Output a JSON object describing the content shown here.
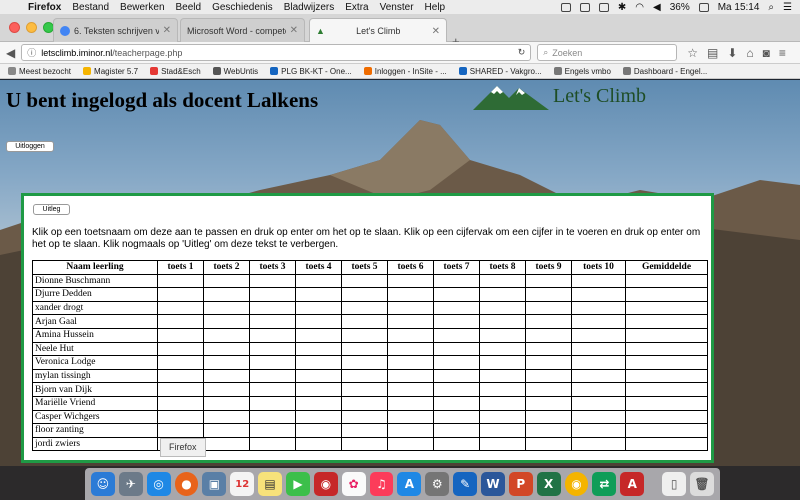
{
  "menubar": {
    "items": [
      "Firefox",
      "Bestand",
      "Bewerken",
      "Beeld",
      "Geschiedenis",
      "Bladwijzers",
      "Extra",
      "Venster",
      "Help"
    ],
    "battery": "36%",
    "clock": "Ma 15:14"
  },
  "tabs": [
    {
      "label": "6. Teksten schrijven voor de..."
    },
    {
      "label": "Microsoft Word - competenties ..."
    },
    {
      "label": "Let's Climb"
    }
  ],
  "navbar": {
    "url_host": "letsclimb.iminor.nl",
    "url_path": "/teacherpage.php",
    "search_placeholder": "Zoeken"
  },
  "bookmarks": [
    "Meest bezocht",
    "Magister 5.7",
    "Stad&Esch",
    "WebUntis",
    "PLG BK-KT - One...",
    "Inloggen - InSite - ...",
    "SHARED - Vakgro...",
    "Engels vmbo",
    "Dashboard - Engel..."
  ],
  "page": {
    "title": "U bent ingelogd als docent Lalkens",
    "brand": "Let's Climb",
    "logout_label": "Uitloggen",
    "uitleg_label": "Uitleg",
    "instructions": "Klik op een toetsnaam om deze aan te passen en druk op enter om het op te slaan. Klik op een cijfervak om een cijfer in te voeren en druk op enter om het op te slaan. Klik nogmaals op 'Uitleg' om deze tekst te verbergen."
  },
  "table": {
    "headers": [
      "Naam leerling",
      "toets 1",
      "toets 2",
      "toets 3",
      "toets 4",
      "toets 5",
      "toets 6",
      "toets 7",
      "toets 8",
      "toets 9",
      "toets 10",
      "Gemiddelde"
    ],
    "students": [
      "Dionne Buschmann",
      "Djurre Dedden",
      "xander drogt",
      "Arjan Gaal",
      "Amina Hussein",
      "Neele Hut",
      "Veronica Lodge",
      "mylan tissingh",
      "Bjorn van Dijk",
      "Mariëlle Vriend",
      "Casper Wichgers",
      "floor zanting",
      "jordi zwiers"
    ]
  },
  "tooltip": "Firefox",
  "colors": {
    "panel_border": "#1f9a45",
    "brand_green": "#1e4d25"
  }
}
